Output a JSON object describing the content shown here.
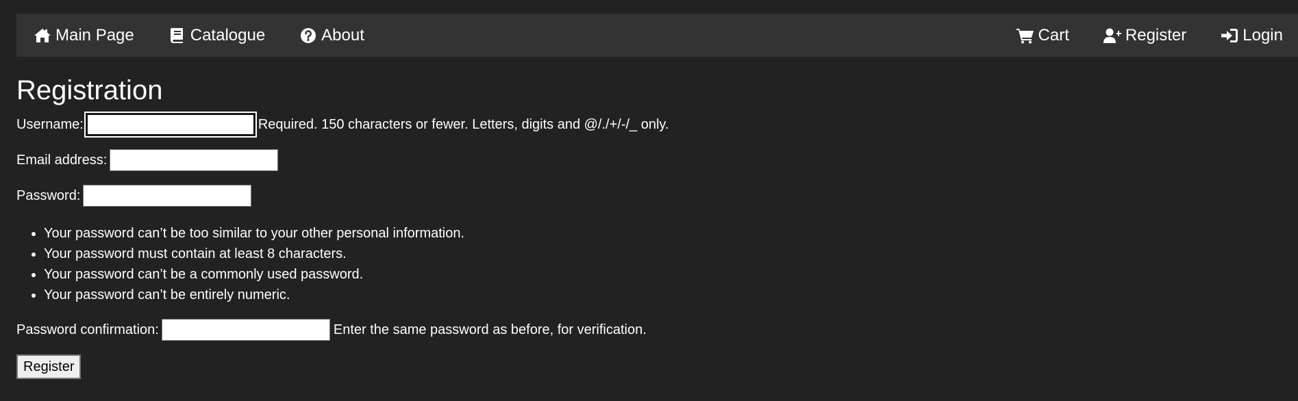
{
  "nav": {
    "left": [
      {
        "label": "Main Page",
        "icon": "home-icon"
      },
      {
        "label": "Catalogue",
        "icon": "book-icon"
      },
      {
        "label": "About",
        "icon": "question-circle-icon"
      }
    ],
    "right": [
      {
        "label": "Cart",
        "icon": "cart-icon"
      },
      {
        "label": "Register",
        "icon": "user-plus-icon"
      },
      {
        "label": "Login",
        "icon": "sign-in-icon"
      }
    ]
  },
  "page": {
    "title": "Registration"
  },
  "form": {
    "username": {
      "label": "Username:",
      "value": "",
      "help": "Required. 150 characters or fewer. Letters, digits and @/./+/-/_ only."
    },
    "email": {
      "label": "Email address:",
      "value": ""
    },
    "password": {
      "label": "Password:",
      "value": "",
      "rules": [
        "Your password can’t be too similar to your other personal information.",
        "Your password must contain at least 8 characters.",
        "Your password can’t be a commonly used password.",
        "Your password can’t be entirely numeric."
      ]
    },
    "password_confirm": {
      "label": "Password confirmation:",
      "value": "",
      "help": "Enter the same password as before, for verification."
    },
    "submit_label": "Register"
  },
  "colors": {
    "background": "#222222",
    "navbar": "#333333",
    "text": "#ffffff"
  }
}
